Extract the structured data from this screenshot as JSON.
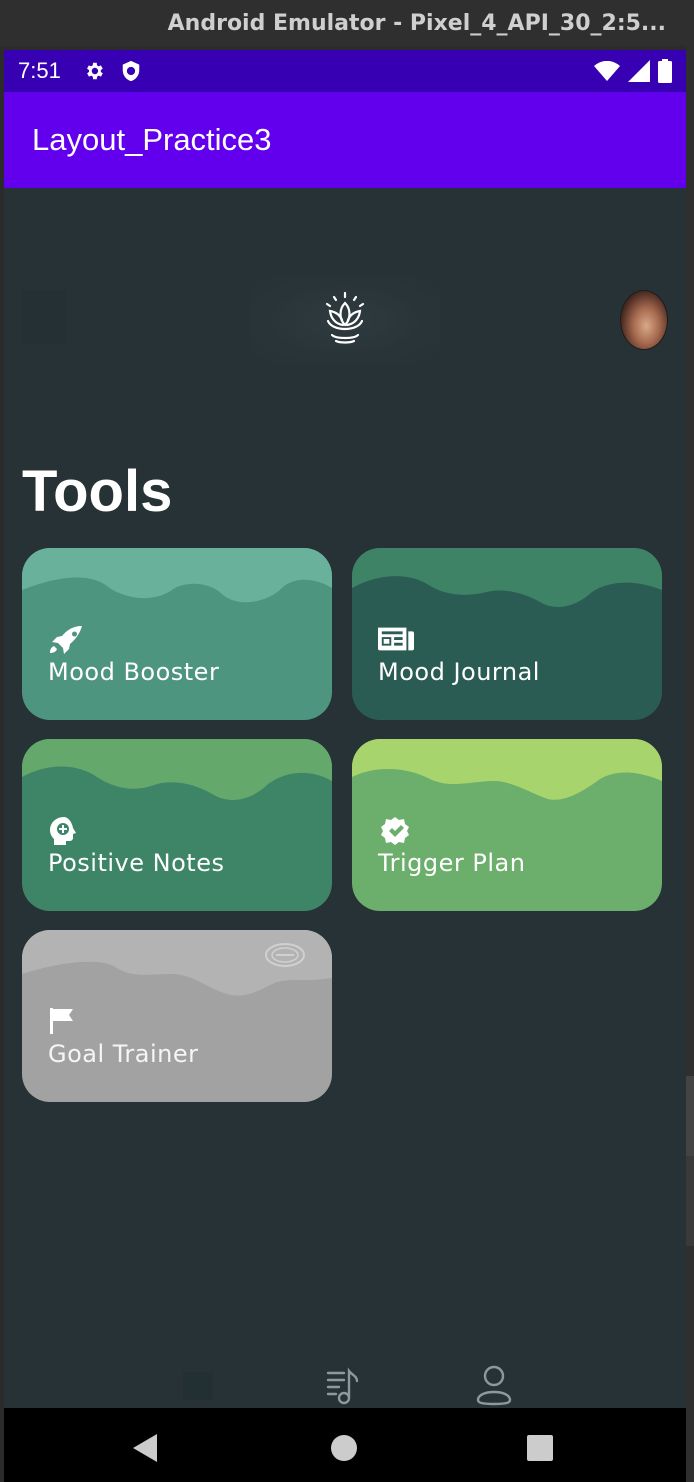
{
  "window": {
    "title": "Android Emulator - Pixel_4_API_30_2:5..."
  },
  "status_bar": {
    "time": "7:51",
    "icons_left": [
      "gear-icon",
      "shield-icon"
    ],
    "icons_right": [
      "wifi-icon",
      "signal-icon",
      "battery-icon"
    ],
    "color": "#3700b3"
  },
  "app_bar": {
    "title": "Layout_Practice3",
    "color": "#6200ee"
  },
  "header": {
    "logo": "lotus-icon",
    "avatar": "avatar"
  },
  "tools": {
    "title": "Tools",
    "items": [
      {
        "label": "Mood Booster",
        "icon": "rocket-icon",
        "top_color": "#6ab19b",
        "body_color": "#4e9580"
      },
      {
        "label": "Mood Journal",
        "icon": "newspaper-icon",
        "top_color": "#3e8366",
        "body_color": "#2a5c54"
      },
      {
        "label": "Positive Notes",
        "icon": "head-plus-icon",
        "top_color": "#64a86c",
        "body_color": "#3e8567"
      },
      {
        "label": "Trigger Plan",
        "icon": "verified-badge-icon",
        "top_color": "#a8d46e",
        "body_color": "#6cae6c"
      },
      {
        "label": "Goal Trainer",
        "icon": "flag-icon",
        "top_color": "#b3b3b3",
        "body_color": "#a2a2a2",
        "disabled": true,
        "badge": "premium-badge-icon"
      }
    ]
  },
  "bottom_nav": {
    "items": [
      {
        "icon": "home-icon"
      },
      {
        "icon": "music-playlist-icon"
      },
      {
        "icon": "profile-icon"
      }
    ]
  },
  "system_nav": {
    "items": [
      {
        "icon": "back-icon"
      },
      {
        "icon": "home-circle-icon"
      },
      {
        "icon": "recents-icon"
      }
    ]
  },
  "colors": {
    "background": "#263235",
    "text": "#ffffff"
  }
}
